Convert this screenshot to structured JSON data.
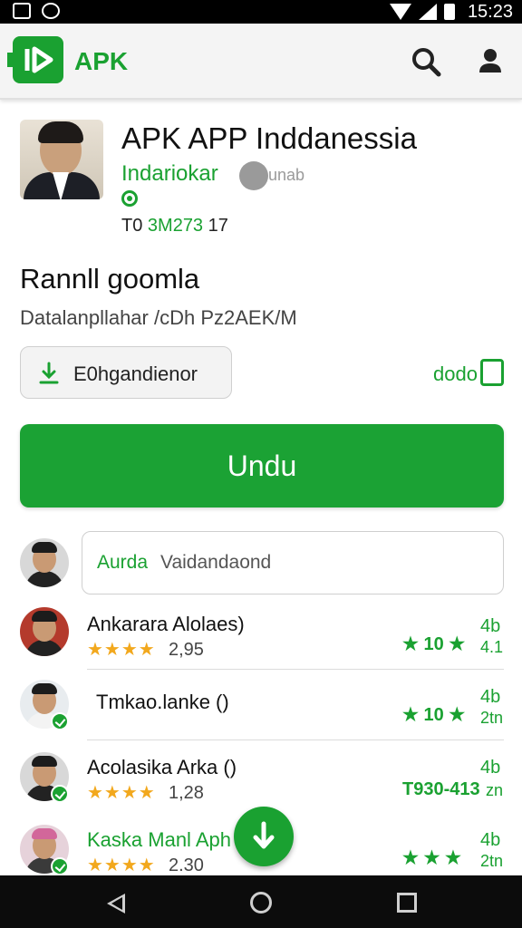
{
  "status_bar": {
    "time": "15:23"
  },
  "app_bar": {
    "brand": "APK",
    "logo_icon": "play-arrow-icon",
    "search_icon": "search-icon",
    "account_icon": "person-icon"
  },
  "app": {
    "title": "APK APP Inddanessia",
    "developer": "Indariokar",
    "developer_badge_text": "unab",
    "meta_prefix": "T0",
    "meta_green": "3M273",
    "meta_suffix": "17"
  },
  "section": {
    "title": "Rannll goomla",
    "subtitle": "Datalanpllahar /cDh Pz2AEK/M"
  },
  "secondary_action": {
    "label": "E0hgandienor",
    "icon": "download-icon"
  },
  "side_link": {
    "label": "dodo"
  },
  "primary_button": {
    "label": "Undu"
  },
  "comment": {
    "label": "Aurda",
    "placeholder": "Vaidandaond"
  },
  "reviews": [
    {
      "name": "Ankarara Alolaes)",
      "stars": "★★★★",
      "rating": "2,95",
      "right_top": "4b",
      "right_main": "★ 10 ★",
      "right_small": "4.1"
    },
    {
      "name": "Tmkao.lanke ()",
      "stars": "",
      "rating": "",
      "right_top": "4b",
      "right_main": "★ 10 ★",
      "right_small": "2tn"
    },
    {
      "name": "Acolasika Arka ()",
      "stars": "★★★★",
      "rating": "1,28",
      "right_top": "4b",
      "right_main": "T930-413",
      "right_small": "zn"
    },
    {
      "name": "Kaska Manl Aph",
      "stars": "★★★★",
      "rating": "2.30",
      "right_top": "4b",
      "right_main": "★ ★ ★",
      "right_small": "2tn"
    }
  ],
  "colors": {
    "accent": "#1aa131",
    "star": "#f2a81d"
  }
}
